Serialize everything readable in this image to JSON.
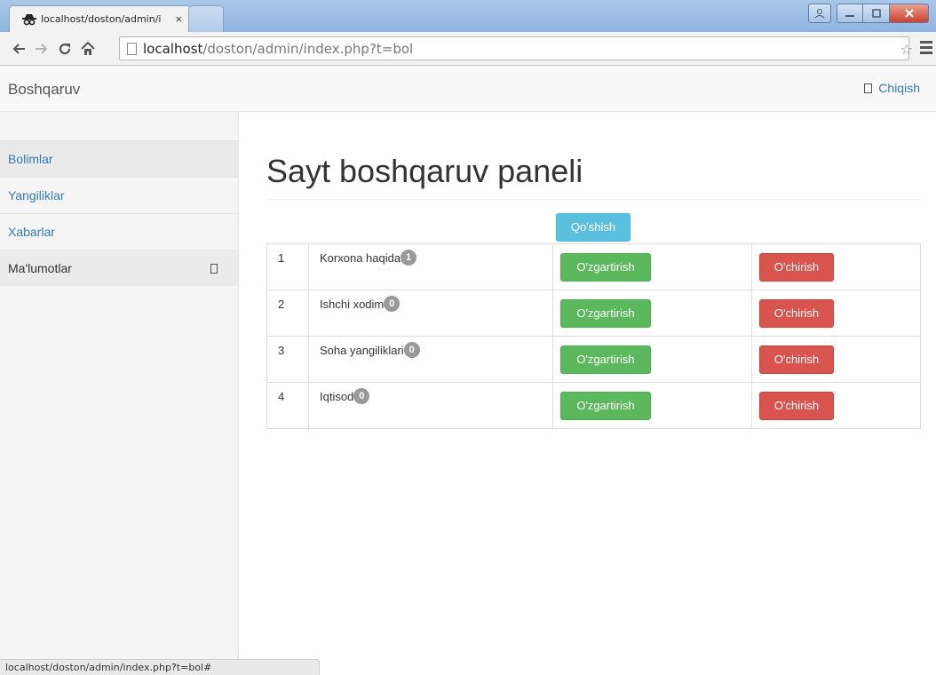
{
  "browser": {
    "tab_title": "localhost/doston/admin/i",
    "tab_close": "×",
    "url_host": "localhost",
    "url_path": "/doston/admin/index.php?t=bol",
    "status_url": "localhost/doston/admin/index.php?t=bol#"
  },
  "navbar": {
    "brand": "Boshqaruv",
    "logout_label": "Chiqish"
  },
  "sidebar": {
    "items": [
      {
        "label": "Bolimlar"
      },
      {
        "label": "Yangiliklar"
      },
      {
        "label": "Xabarlar"
      },
      {
        "label": "Ma'lumotlar"
      }
    ]
  },
  "main": {
    "title": "Sayt boshqaruv paneli",
    "add_label": "Qo'shish",
    "edit_label": "O'zgartirish",
    "delete_label": "O'chirish",
    "rows": [
      {
        "num": "1",
        "name": "Korxona haqida",
        "count": "1"
      },
      {
        "num": "2",
        "name": "Ishchi xodim",
        "count": "0"
      },
      {
        "num": "3",
        "name": "Soha yangiliklari",
        "count": "0"
      },
      {
        "num": "4",
        "name": "Iqtisod",
        "count": "0"
      }
    ]
  },
  "colors": {
    "link": "#337ab7",
    "info": "#5bc0de",
    "success": "#5cb85c",
    "danger": "#d9534f",
    "badge": "#999999"
  },
  "icons": {
    "tab_favicon": "spy-icon",
    "back": "back-arrow-icon",
    "forward": "forward-arrow-icon",
    "reload": "reload-icon",
    "home": "home-icon",
    "page": "page-icon",
    "bookmark": "star-icon",
    "menu": "menu-icon",
    "logout": "log-out-icon",
    "expand": "chevron-icon"
  }
}
